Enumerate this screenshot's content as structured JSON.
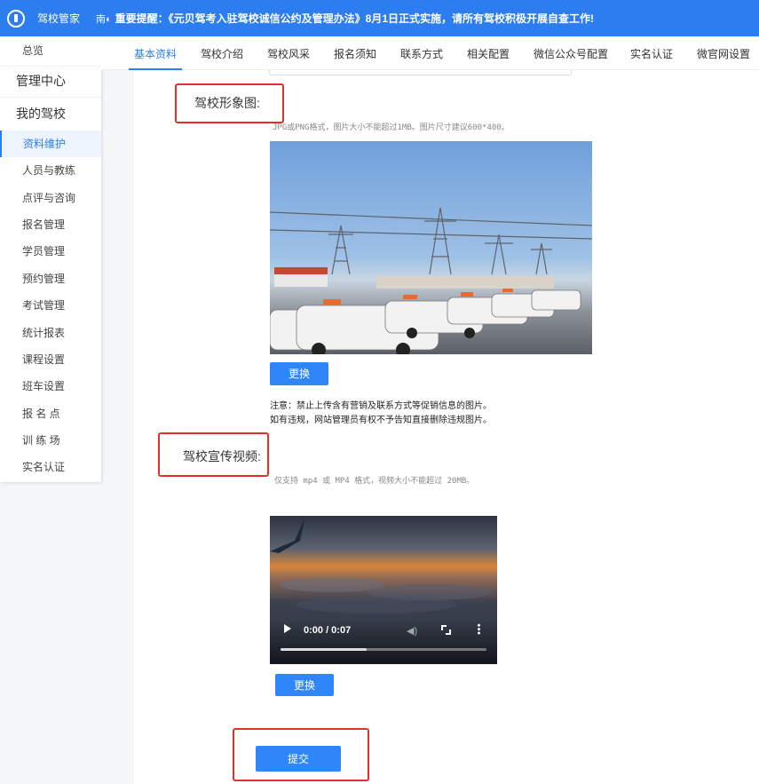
{
  "header": {
    "app_title": "驾校管家",
    "notice_icon": "南◐",
    "notice_text": "重要提醒：《元贝驾考入驻驾校诚信公约及管理办法》8月1日正式实施，请所有驾校积极开展自查工作!",
    "logo_icon": "logo-icon"
  },
  "sidebar": {
    "items": [
      {
        "label": "总览"
      },
      {
        "label": "管理中心"
      },
      {
        "label": "我的驾校"
      },
      {
        "label": "资料维护"
      },
      {
        "label": "人员与教练"
      },
      {
        "label": "点评与咨询"
      },
      {
        "label": "报名管理"
      },
      {
        "label": "学员管理"
      },
      {
        "label": "预约管理"
      },
      {
        "label": "考试管理"
      },
      {
        "label": "统计报表"
      },
      {
        "label": "课程设置"
      },
      {
        "label": "班车设置"
      },
      {
        "label": "报 名 点"
      },
      {
        "label": "训 练 场"
      },
      {
        "label": "实名认证"
      }
    ]
  },
  "tabs": [
    {
      "label": "基本资料"
    },
    {
      "label": "驾校介绍"
    },
    {
      "label": "驾校风采"
    },
    {
      "label": "报名须知"
    },
    {
      "label": "联系方式"
    },
    {
      "label": "相关配置"
    },
    {
      "label": "微信公众号配置"
    },
    {
      "label": "实名认证"
    },
    {
      "label": "微官网设置"
    }
  ],
  "image_section": {
    "label": "驾校形象图:",
    "hint": "JPG或PNG格式，图片大小不能超过1MB。图片尺寸建议600*400。",
    "change_button": "更换",
    "warning_line1": "注意：禁止上传含有营销及联系方式等促销信息的图片。",
    "warning_line2": "如有违规，网站管理员有权不予告知直接删除违规图片。"
  },
  "video_section": {
    "label": "驾校宣传视频:",
    "hint": "仅支持 mp4 或 MP4 格式，视频大小不能超过 20MB。",
    "time": "0:00 / 0:07",
    "progress": 0.42,
    "change_button": "更换"
  },
  "submit_button": "提交",
  "colors": {
    "primary": "#2b7df0",
    "button": "#2e86f8",
    "highlight_box": "#e4302b"
  }
}
